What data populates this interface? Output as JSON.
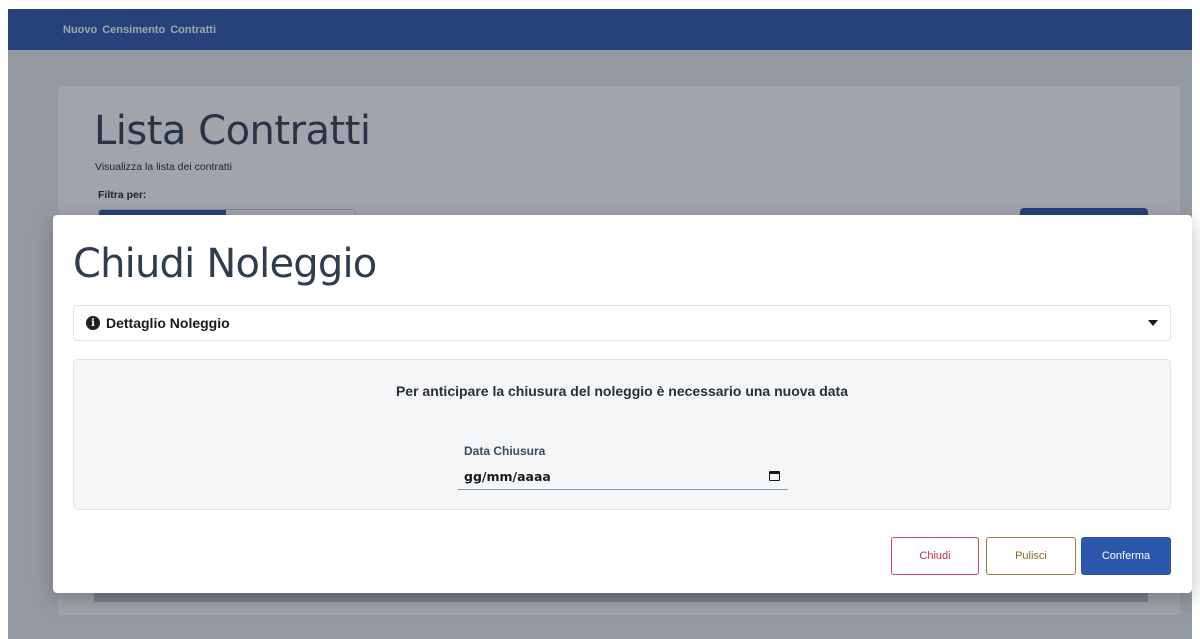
{
  "nav": {
    "items": [
      "Nuovo",
      "Censimento",
      "Contratti"
    ]
  },
  "page": {
    "title": "Lista Contratti",
    "subtitle": "Visualizza la lista dei contratti",
    "filter_label": "Filtra per:"
  },
  "modal": {
    "title": "Chiudi Noleggio",
    "accordion_label": "Dettaglio Noleggio",
    "info_message": "Per anticipare la chiusura del noleggio è necessario una nuova data",
    "date_field": {
      "label": "Data Chiusura",
      "value": "gg/mm/aaaa"
    },
    "buttons": {
      "close": "Chiudi",
      "clear": "Pulisci",
      "confirm": "Conferma"
    }
  },
  "colors": {
    "primary": "#2b57ad",
    "danger": "#c0303f",
    "warning": "#8a6a24",
    "title_text": "#2f3d51"
  }
}
